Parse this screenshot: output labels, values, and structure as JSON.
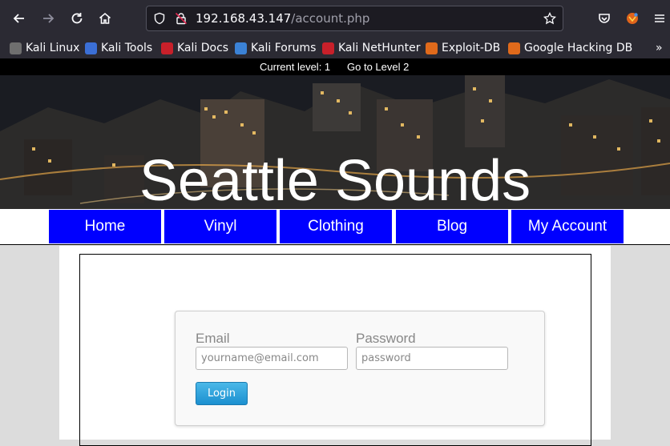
{
  "browser": {
    "url_host": "192.168.43.147",
    "url_path": "/account.php",
    "bookmarks": [
      {
        "label": "Kali Linux",
        "icon": "kali-dragon-icon",
        "color": "#6f6f6f"
      },
      {
        "label": "Kali Tools",
        "icon": "kali-tools-icon",
        "color": "#3b6fd6"
      },
      {
        "label": "Kali Docs",
        "icon": "kali-docs-icon",
        "color": "#c8202a"
      },
      {
        "label": "Kali Forums",
        "icon": "kali-forums-icon",
        "color": "#3b82d6"
      },
      {
        "label": "Kali NetHunter",
        "icon": "kali-nethunter-icon",
        "color": "#c8202a"
      },
      {
        "label": "Exploit-DB",
        "icon": "exploit-db-icon",
        "color": "#e06a1b"
      },
      {
        "label": "Google Hacking DB",
        "icon": "google-hacking-db-icon",
        "color": "#e06a1b"
      }
    ],
    "overflow_label": "»"
  },
  "levelbar": {
    "current_level": "Current level: 1",
    "goto_level": "Go to Level 2"
  },
  "site": {
    "title": "Seattle Sounds"
  },
  "menu": [
    {
      "label": "Home"
    },
    {
      "label": "Vinyl"
    },
    {
      "label": "Clothing"
    },
    {
      "label": "Blog"
    },
    {
      "label": "My Account"
    }
  ],
  "login": {
    "email_label": "Email",
    "email_placeholder": "yourname@email.com",
    "password_label": "Password",
    "password_placeholder": "password",
    "button_label": "Login"
  },
  "colors": {
    "menu_bg": "#0000ff",
    "button_bg": "#1c90d0",
    "levelbar_bg": "#000000"
  }
}
